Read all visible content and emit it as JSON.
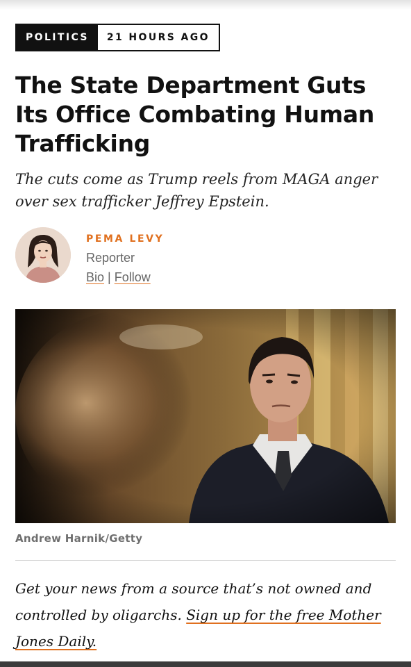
{
  "article": {
    "category": "POLITICS",
    "timestamp": "21 HOURS AGO",
    "headline": "The State Department Guts Its Office Combating Human Trafficking",
    "dek": "The cuts come as Trump reels from MAGA anger over sex trafficker Jeffrey Epstein."
  },
  "author": {
    "name": "PEMA LEVY",
    "role": "Reporter",
    "bio_link": "Bio",
    "separator": "|",
    "follow_link": "Follow"
  },
  "image": {
    "credit": "Andrew Harnik/Getty"
  },
  "promo": {
    "text": "Get your news from a source that’s not owned and controlled by oligarchs. ",
    "link_text": "Sign up for the free Mother Jones Daily."
  },
  "colors": {
    "accent": "#e0701f",
    "text": "#111111",
    "muted": "#666666"
  }
}
